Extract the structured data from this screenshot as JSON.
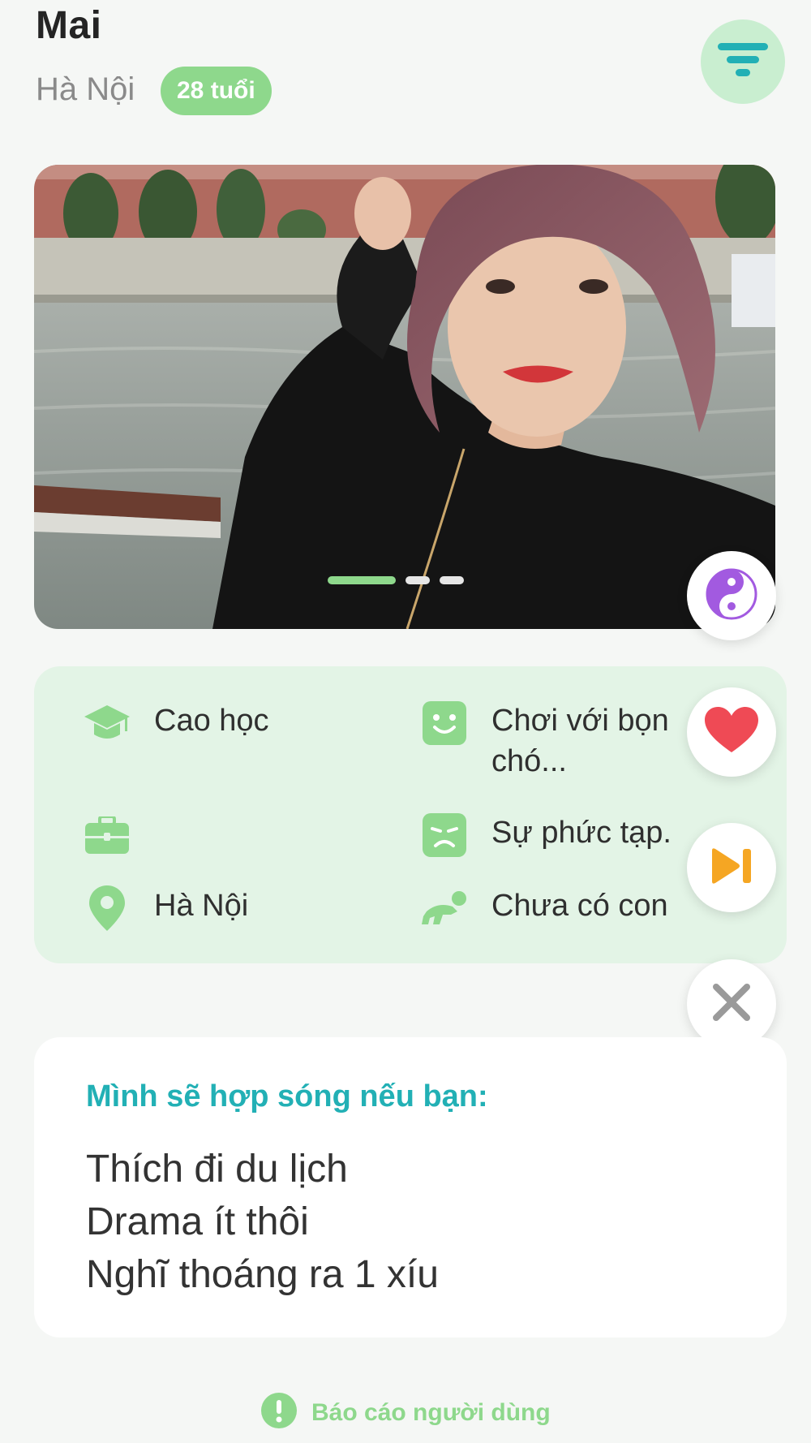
{
  "profile": {
    "name": "Mai",
    "city": "Hà Nội",
    "age": "28 tuổi"
  },
  "photo": {
    "count": 3,
    "active_index": 0
  },
  "info": {
    "education": "Cao học",
    "hobby": "Chơi với bọn chó...",
    "hobby_line1": "Chơi với bọn",
    "hobby_line2": "chó...",
    "job": "",
    "dislike": "Sự phức tạp.",
    "location": "Hà Nội",
    "children": "Chưa có con"
  },
  "bio": {
    "title": "Mình sẽ hợp sóng nếu bạn:",
    "lines": [
      "Thích đi du lịch",
      "Drama ít thôi",
      "Nghĩ thoáng ra 1 xíu"
    ]
  },
  "report": {
    "label": "Báo cáo người dùng"
  },
  "colors": {
    "accent_green": "#8ed88c",
    "accent_teal": "#22b0b5",
    "info_bg": "#e3f4e6",
    "like_red": "#ef4a55",
    "skip_orange": "#f5a623",
    "purple": "#a25ae0"
  },
  "icons": {
    "filter": "filter-icon",
    "compat": "yin-yang-icon",
    "like": "heart-icon",
    "skip": "skip-icon",
    "dislike": "close-icon",
    "education": "graduation-cap-icon",
    "hobby": "smile-icon",
    "job": "briefcase-icon",
    "dislike_info": "sad-face-icon",
    "location": "location-pin-icon",
    "children": "baby-icon",
    "report": "alert-icon"
  }
}
